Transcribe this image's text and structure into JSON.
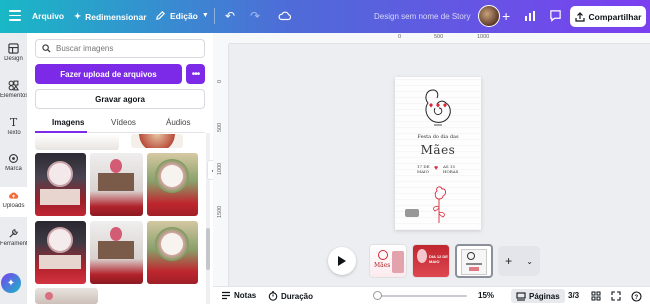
{
  "topbar": {
    "file_label": "Arquivo",
    "resize_label": "Redimensionar",
    "edit_label": "Edição",
    "document_name": "Design sem nome de Story",
    "share_label": "Compartilhar"
  },
  "rail": {
    "items": [
      {
        "label": "Design",
        "icon": "layout-icon"
      },
      {
        "label": "Elementos",
        "icon": "shapes-icon"
      },
      {
        "label": "Texto",
        "icon": "text-icon"
      },
      {
        "label": "Marca",
        "icon": "crown-icon"
      },
      {
        "label": "Uploads",
        "icon": "cloud-upload-icon"
      },
      {
        "label": "Ferramentas",
        "icon": "wrench-icon"
      }
    ]
  },
  "panel": {
    "search_placeholder": "Buscar imagens",
    "upload_label": "Fazer upload de arquivos",
    "more_label": "•••",
    "record_label": "Gravar agora",
    "tabs": [
      "Imagens",
      "Vídeos",
      "Áudios"
    ],
    "active_tab": "Imagens"
  },
  "ruler": {
    "top_ticks": [
      "0",
      "500",
      "1000"
    ],
    "left_ticks": [
      "0",
      "500",
      "1000",
      "1500"
    ]
  },
  "design": {
    "title_line1": "Festa do dia das",
    "title_line2": "Mães",
    "date_left_1": "17 DE",
    "date_left_2": "MAIO",
    "date_right_1": "AS 15",
    "date_right_2": "HORAS"
  },
  "pages_strip": {
    "thumb_labels": [
      "Mães",
      "DIA 12 DE MAIO",
      ""
    ]
  },
  "bottombar": {
    "notes_label": "Notas",
    "duration_label": "Duração",
    "zoom_value": "15%",
    "pages_label": "Páginas",
    "page_count": "3/3"
  },
  "colors": {
    "accent": "#7d2ae8",
    "gradient_start": "#19b8c6",
    "gradient_end": "#7b3ff0",
    "heart": "#d62839"
  }
}
